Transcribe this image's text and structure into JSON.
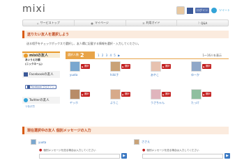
{
  "app": {
    "logo": "mixi"
  },
  "header": {
    "fb_label": "ログイン",
    "twitter_label": "ツイート"
  },
  "nav": {
    "items": [
      {
        "label": "サービストップ",
        "icon": "house-icon"
      },
      {
        "label": "マイページ",
        "icon": "person-icon"
      },
      {
        "label": "利用ガイド",
        "icon": "gear-icon"
      },
      {
        "label": "Q&A",
        "icon": "question-icon"
      }
    ]
  },
  "section1": {
    "title": "送りたい友人を選択しよう"
  },
  "instructions": {
    "line1": "送る相手をチェックボックスで選択し、友人欄に記載する情報を選択・入力してください。"
  },
  "sidebar": {
    "mixi_title": "mixiの友人",
    "mixi_sub1": "あいうえお順",
    "mixi_sub2": "(ニックネーム)",
    "facebook_title": "Facebookの友人",
    "facebook_button": "Facebookでログイン",
    "twitter_title": "Twitterの友人",
    "twitter_link": "つなげ方"
  },
  "main": {
    "selected_label": "選択人数",
    "selected_count": "2",
    "pager": "1 2 3 4 5 ▶",
    "count_text": "1〜16人を表示",
    "select_label": "選択",
    "friends": [
      {
        "name": "yuota",
        "color": "#7aa7cf"
      },
      {
        "name": "hiiki子",
        "color": "#c9a277"
      },
      {
        "name": "あやこ",
        "color": "#e7c2b0"
      },
      {
        "name": "ゆーか",
        "color": "#8fa7c8"
      },
      {
        "name": "ヤッホ",
        "color": "#b88c68"
      },
      {
        "name": "よりこ",
        "color": "#d7aa8a"
      },
      {
        "name": "うさちゃん",
        "color": "#e0b5bd"
      },
      {
        "name": "たっけ",
        "color": "#8fbf9f"
      }
    ]
  },
  "section2": {
    "title": "現在選択中の友人 個別メッセージの入力"
  },
  "bottom": {
    "friend1": "yuota",
    "friend2": "ささえ",
    "hint": "個別メッセージを送る場合は入力してください"
  }
}
